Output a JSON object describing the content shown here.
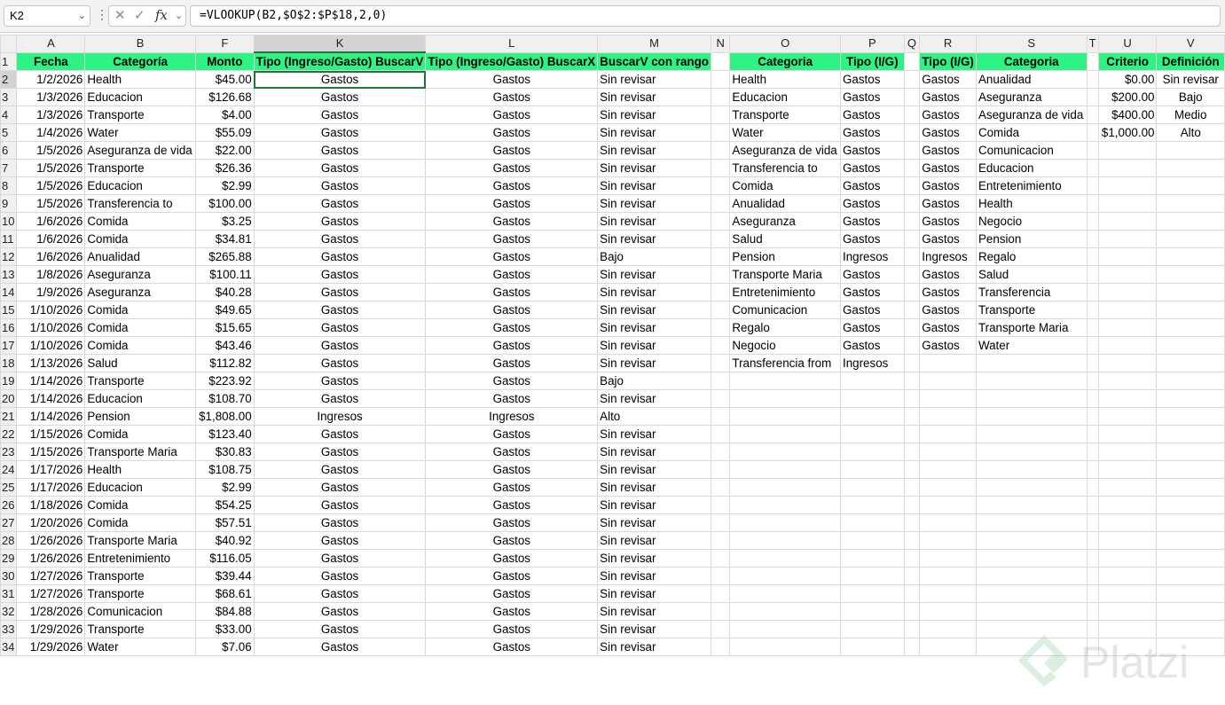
{
  "formula_bar": {
    "cell_ref": "K2",
    "formula": "=VLOOKUP(B2,$O$2:$P$18,2,0)",
    "cancel_glyph": "✕",
    "confirm_glyph": "✓",
    "fx_glyph": "fx"
  },
  "columns": [
    "A",
    "B",
    "F",
    "K",
    "L",
    "M",
    "N",
    "O",
    "P",
    "Q",
    "R",
    "S",
    "T",
    "U",
    "V"
  ],
  "headers": {
    "A": "Fecha",
    "B": "Categoría",
    "F": "Monto",
    "K": "Tipo (Ingreso/Gasto) BuscarV",
    "L": "Tipo (Ingreso/Gasto) BuscarX",
    "M": "BuscarV con rango",
    "O": "Categoria",
    "P": "Tipo (I/G)",
    "R": "Tipo (I/G)",
    "S": "Categoria",
    "U": "Criterio",
    "V": "Definición"
  },
  "main_rows": [
    [
      "2",
      "1/2/2026",
      "Health",
      "$45.00",
      "Gastos",
      "Gastos",
      "Sin revisar"
    ],
    [
      "3",
      "1/3/2026",
      "Educacion",
      "$126.68",
      "Gastos",
      "Gastos",
      "Sin revisar"
    ],
    [
      "4",
      "1/3/2026",
      "Transporte",
      "$4.00",
      "Gastos",
      "Gastos",
      "Sin revisar"
    ],
    [
      "5",
      "1/4/2026",
      "Water",
      "$55.09",
      "Gastos",
      "Gastos",
      "Sin revisar"
    ],
    [
      "6",
      "1/5/2026",
      "Aseguranza de vida",
      "$22.00",
      "Gastos",
      "Gastos",
      "Sin revisar"
    ],
    [
      "7",
      "1/5/2026",
      "Transporte",
      "$26.36",
      "Gastos",
      "Gastos",
      "Sin revisar"
    ],
    [
      "8",
      "1/5/2026",
      "Educacion",
      "$2.99",
      "Gastos",
      "Gastos",
      "Sin revisar"
    ],
    [
      "9",
      "1/5/2026",
      "Transferencia to",
      "$100.00",
      "Gastos",
      "Gastos",
      "Sin revisar"
    ],
    [
      "10",
      "1/6/2026",
      "Comida",
      "$3.25",
      "Gastos",
      "Gastos",
      "Sin revisar"
    ],
    [
      "11",
      "1/6/2026",
      "Comida",
      "$34.81",
      "Gastos",
      "Gastos",
      "Sin revisar"
    ],
    [
      "12",
      "1/6/2026",
      "Anualidad",
      "$265.88",
      "Gastos",
      "Gastos",
      "Bajo"
    ],
    [
      "13",
      "1/8/2026",
      "Aseguranza",
      "$100.11",
      "Gastos",
      "Gastos",
      "Sin revisar"
    ],
    [
      "14",
      "1/9/2026",
      "Aseguranza",
      "$40.28",
      "Gastos",
      "Gastos",
      "Sin revisar"
    ],
    [
      "15",
      "1/10/2026",
      "Comida",
      "$49.65",
      "Gastos",
      "Gastos",
      "Sin revisar"
    ],
    [
      "16",
      "1/10/2026",
      "Comida",
      "$15.65",
      "Gastos",
      "Gastos",
      "Sin revisar"
    ],
    [
      "17",
      "1/10/2026",
      "Comida",
      "$43.46",
      "Gastos",
      "Gastos",
      "Sin revisar"
    ],
    [
      "18",
      "1/13/2026",
      "Salud",
      "$112.82",
      "Gastos",
      "Gastos",
      "Sin revisar"
    ],
    [
      "19",
      "1/14/2026",
      "Transporte",
      "$223.92",
      "Gastos",
      "Gastos",
      "Bajo"
    ],
    [
      "20",
      "1/14/2026",
      "Educacion",
      "$108.70",
      "Gastos",
      "Gastos",
      "Sin revisar"
    ],
    [
      "21",
      "1/14/2026",
      "Pension",
      "$1,808.00",
      "Ingresos",
      "Ingresos",
      "Alto"
    ],
    [
      "22",
      "1/15/2026",
      "Comida",
      "$123.40",
      "Gastos",
      "Gastos",
      "Sin revisar"
    ],
    [
      "23",
      "1/15/2026",
      "Transporte Maria",
      "$30.83",
      "Gastos",
      "Gastos",
      "Sin revisar"
    ],
    [
      "24",
      "1/17/2026",
      "Health",
      "$108.75",
      "Gastos",
      "Gastos",
      "Sin revisar"
    ],
    [
      "25",
      "1/17/2026",
      "Educacion",
      "$2.99",
      "Gastos",
      "Gastos",
      "Sin revisar"
    ],
    [
      "26",
      "1/18/2026",
      "Comida",
      "$54.25",
      "Gastos",
      "Gastos",
      "Sin revisar"
    ],
    [
      "27",
      "1/20/2026",
      "Comida",
      "$57.51",
      "Gastos",
      "Gastos",
      "Sin revisar"
    ],
    [
      "28",
      "1/26/2026",
      "Transporte Maria",
      "$40.92",
      "Gastos",
      "Gastos",
      "Sin revisar"
    ],
    [
      "29",
      "1/26/2026",
      "Entretenimiento",
      "$116.05",
      "Gastos",
      "Gastos",
      "Sin revisar"
    ],
    [
      "30",
      "1/27/2026",
      "Transporte",
      "$39.44",
      "Gastos",
      "Gastos",
      "Sin revisar"
    ],
    [
      "31",
      "1/27/2026",
      "Transporte",
      "$68.61",
      "Gastos",
      "Gastos",
      "Sin revisar"
    ],
    [
      "32",
      "1/28/2026",
      "Comunicacion",
      "$84.88",
      "Gastos",
      "Gastos",
      "Sin revisar"
    ],
    [
      "33",
      "1/29/2026",
      "Transporte",
      "$33.00",
      "Gastos",
      "Gastos",
      "Sin revisar"
    ],
    [
      "34",
      "1/29/2026",
      "Water",
      "$7.06",
      "Gastos",
      "Gastos",
      "Sin revisar"
    ]
  ],
  "lookup_op": [
    [
      "Health",
      "Gastos"
    ],
    [
      "Educacion",
      "Gastos"
    ],
    [
      "Transporte",
      "Gastos"
    ],
    [
      "Water",
      "Gastos"
    ],
    [
      "Aseguranza de vida",
      "Gastos"
    ],
    [
      "Transferencia to",
      "Gastos"
    ],
    [
      "Comida",
      "Gastos"
    ],
    [
      "Anualidad",
      "Gastos"
    ],
    [
      "Aseguranza",
      "Gastos"
    ],
    [
      "Salud",
      "Gastos"
    ],
    [
      "Pension",
      "Ingresos"
    ],
    [
      "Transporte Maria",
      "Gastos"
    ],
    [
      "Entretenimiento",
      "Gastos"
    ],
    [
      "Comunicacion",
      "Gastos"
    ],
    [
      "Regalo",
      "Gastos"
    ],
    [
      "Negocio",
      "Gastos"
    ],
    [
      "Transferencia from",
      "Ingresos"
    ]
  ],
  "lookup_rs": [
    [
      "Gastos",
      "Anualidad"
    ],
    [
      "Gastos",
      "Aseguranza"
    ],
    [
      "Gastos",
      "Aseguranza de vida"
    ],
    [
      "Gastos",
      "Comida"
    ],
    [
      "Gastos",
      "Comunicacion"
    ],
    [
      "Gastos",
      "Educacion"
    ],
    [
      "Gastos",
      "Entretenimiento"
    ],
    [
      "Gastos",
      "Health"
    ],
    [
      "Gastos",
      "Negocio"
    ],
    [
      "Gastos",
      "Pension"
    ],
    [
      "Ingresos",
      "Regalo"
    ],
    [
      "Gastos",
      "Salud"
    ],
    [
      "Gastos",
      "Transferencia"
    ],
    [
      "Gastos",
      "Transporte"
    ],
    [
      "Gastos",
      "Transporte Maria"
    ],
    [
      "Gastos",
      "Water"
    ]
  ],
  "criteria_uv": [
    [
      "$0.00",
      "Sin revisar"
    ],
    [
      "$200.00",
      "Bajo"
    ],
    [
      "$400.00",
      "Medio"
    ],
    [
      "$1,000.00",
      "Alto"
    ]
  ],
  "watermark": "Platzi",
  "colors": {
    "header_fill": "#2ef284",
    "selection_green": "#217346"
  }
}
